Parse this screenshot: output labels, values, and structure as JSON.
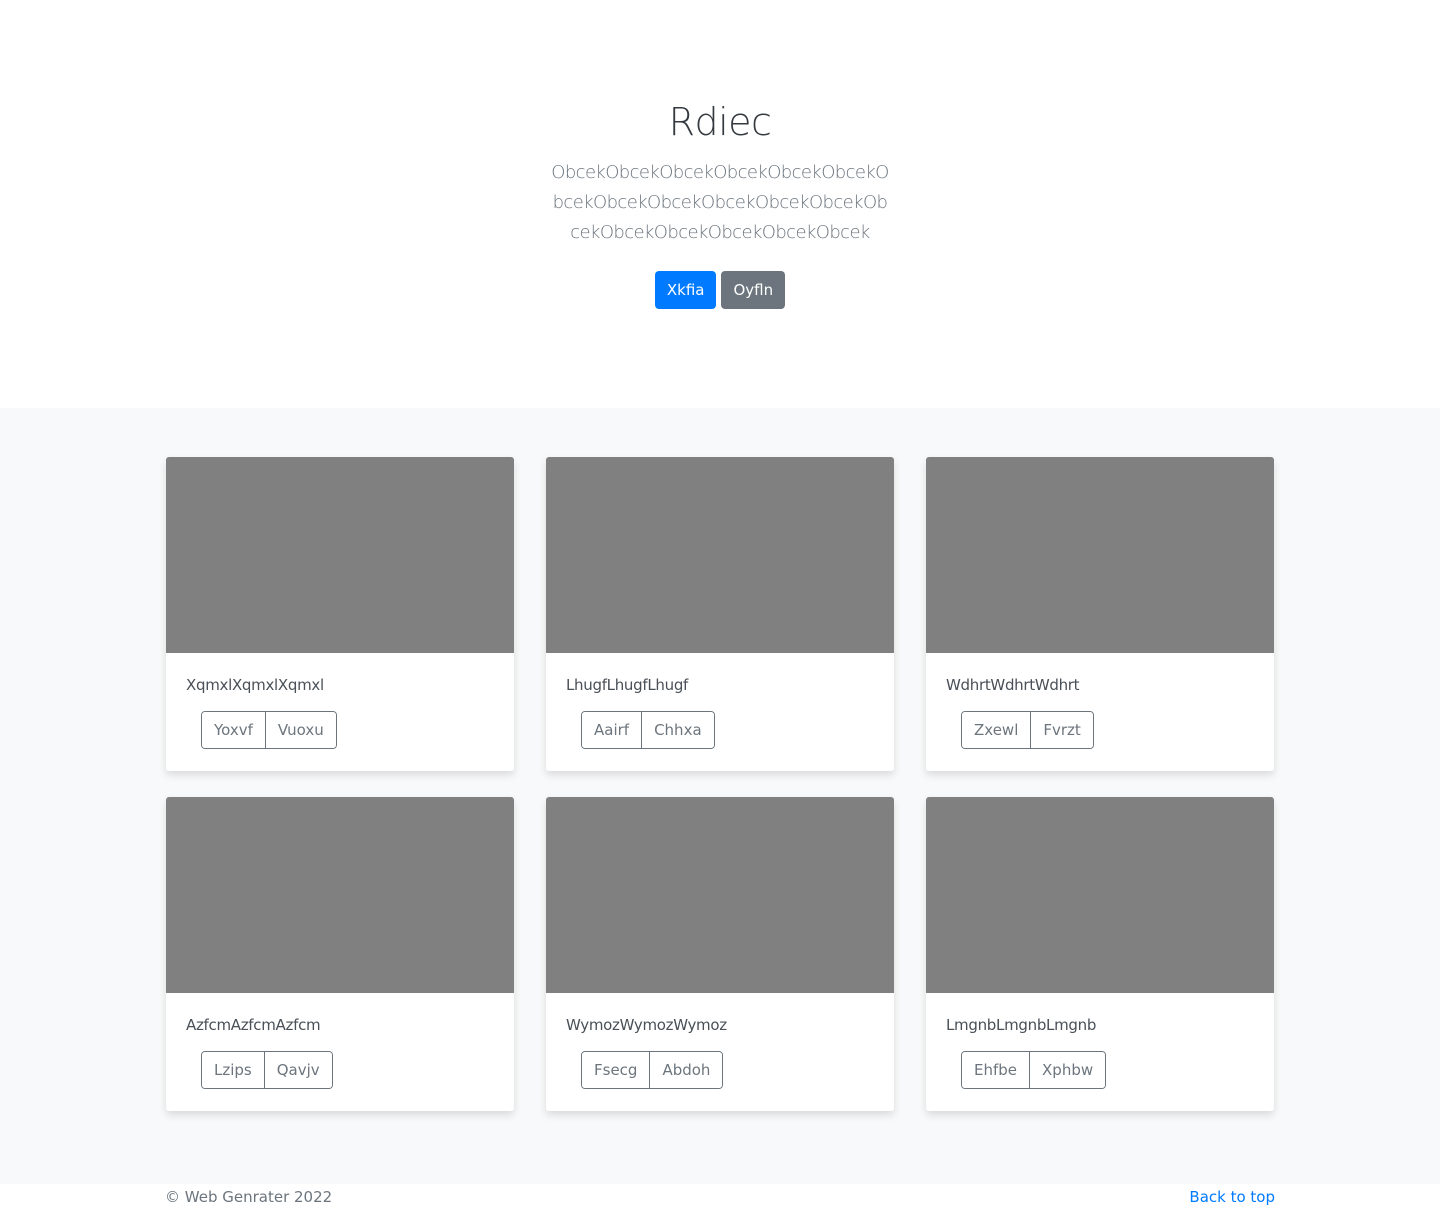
{
  "hero": {
    "title": "Rdiec",
    "lead": "ObcekObcekObcekObcekObcekObcekObcekObcekObcekObcekObcekObcekObcekObcekObcekObcekObcekObcek",
    "primary_button": "Xkfia",
    "secondary_button": "Oyfln"
  },
  "cards": [
    {
      "text": "XqmxlXqmxlXqmxl",
      "buttons": [
        "Yoxvf",
        "Vuoxu"
      ]
    },
    {
      "text": "LhugfLhugfLhugf",
      "buttons": [
        "Aairf",
        "Chhxa"
      ]
    },
    {
      "text": "WdhrtWdhrtWdhrt",
      "buttons": [
        "Zxewl",
        "Fvrzt"
      ]
    },
    {
      "text": "AzfcmAzfcmAzfcm",
      "buttons": [
        "Lzips",
        "Qavjv"
      ]
    },
    {
      "text": "WymozWymozWymoz",
      "buttons": [
        "Fsecg",
        "Abdoh"
      ]
    },
    {
      "text": "LmgnbLmgnbLmgnb",
      "buttons": [
        "Ehfbe",
        "Xphbw"
      ]
    }
  ],
  "footer": {
    "copyright": "© Web Genrater 2022",
    "back_to_top": "Back to top"
  },
  "colors": {
    "primary": "#007bff",
    "secondary": "#6c757d",
    "thumbnail": "#808080"
  }
}
